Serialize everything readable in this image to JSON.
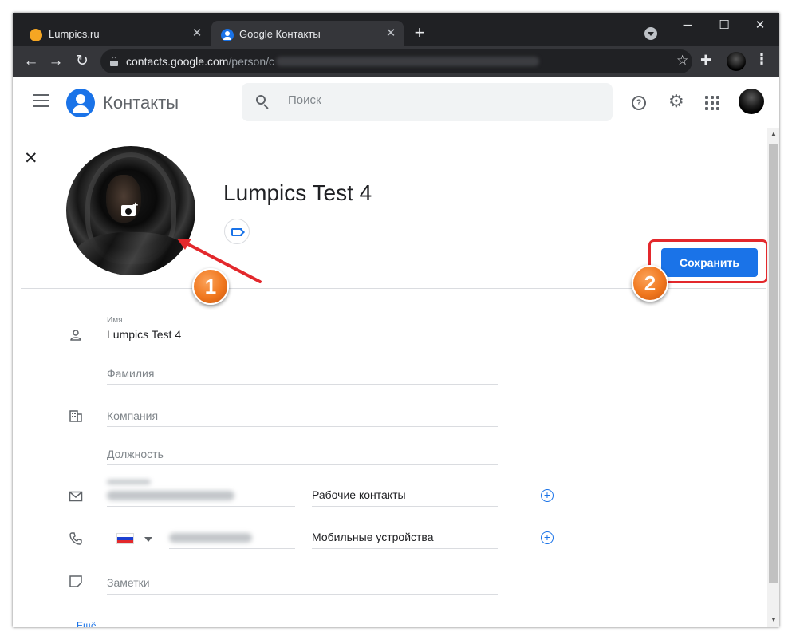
{
  "browser": {
    "tabs": [
      {
        "title": "Lumpics.ru",
        "favicon": "lumpics-favicon"
      },
      {
        "title": "Google Контакты",
        "favicon": "contacts-favicon"
      }
    ],
    "url_host": "contacts.google.com",
    "url_path": "/person/c",
    "window_controls": {
      "minimize": "─",
      "maximize": "☐",
      "close": "✕"
    }
  },
  "header": {
    "app_title": "Контакты",
    "search_placeholder": "Поиск"
  },
  "contact": {
    "display_name": "Lumpics Test 4",
    "save_label": "Сохранить"
  },
  "annotations": {
    "badge1": "1",
    "badge2": "2"
  },
  "form": {
    "name_label": "Имя",
    "name_value": "Lumpics Test 4",
    "surname_placeholder": "Фамилия",
    "company_placeholder": "Компания",
    "position_placeholder": "Должность",
    "email_type": "Рабочие контакты",
    "phone_type": "Мобильные устройства",
    "notes_placeholder": "Заметки",
    "more_link": "Ещё"
  },
  "colors": {
    "accent": "#1a73e8",
    "annotation_red": "#e3282c",
    "badge_orange": "#f0771e"
  }
}
